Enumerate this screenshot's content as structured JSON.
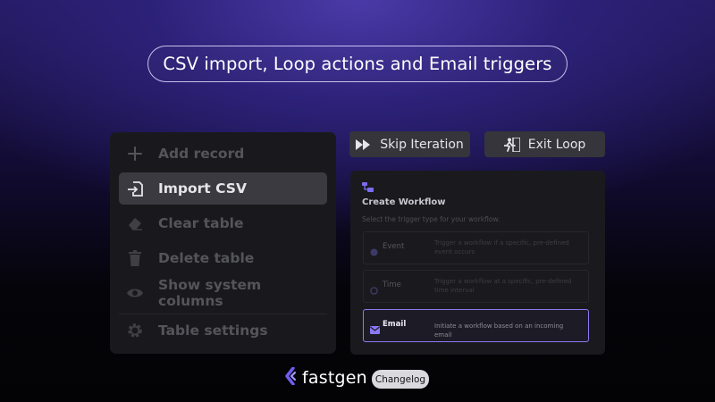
{
  "title": "CSV import, Loop actions and Email triggers",
  "menu": {
    "items": [
      {
        "label": "Add record",
        "icon": "plus-icon"
      },
      {
        "label": "Import CSV",
        "icon": "import-icon"
      },
      {
        "label": "Clear table",
        "icon": "eraser-icon"
      },
      {
        "label": "Delete table",
        "icon": "trash-icon"
      },
      {
        "label": "Show system columns",
        "icon": "eye-icon"
      },
      {
        "label": "Table settings",
        "icon": "gear-icon"
      }
    ],
    "active_index": 1
  },
  "loop": {
    "skip_label": "Skip Iteration",
    "exit_label": "Exit Loop"
  },
  "workflow": {
    "title": "Create Workflow",
    "subtitle": "Select the trigger type for your workflow.",
    "options": [
      {
        "label": "Event",
        "description": "Trigger a workflow if a specific, pre-defined event occurs",
        "icon": "event-icon"
      },
      {
        "label": "Time",
        "description": "Trigger a workflow at a specific, pre-defined time interval",
        "icon": "clock-icon"
      },
      {
        "label": "Email",
        "description": "Initiate a workflow based on an incoming email",
        "icon": "mail-icon"
      }
    ],
    "selected": "Email"
  },
  "footer": {
    "brand": "fastgen",
    "badge": "Changelog"
  },
  "colors": {
    "accent": "#8a7af2",
    "brand": "#6f5cf0"
  }
}
